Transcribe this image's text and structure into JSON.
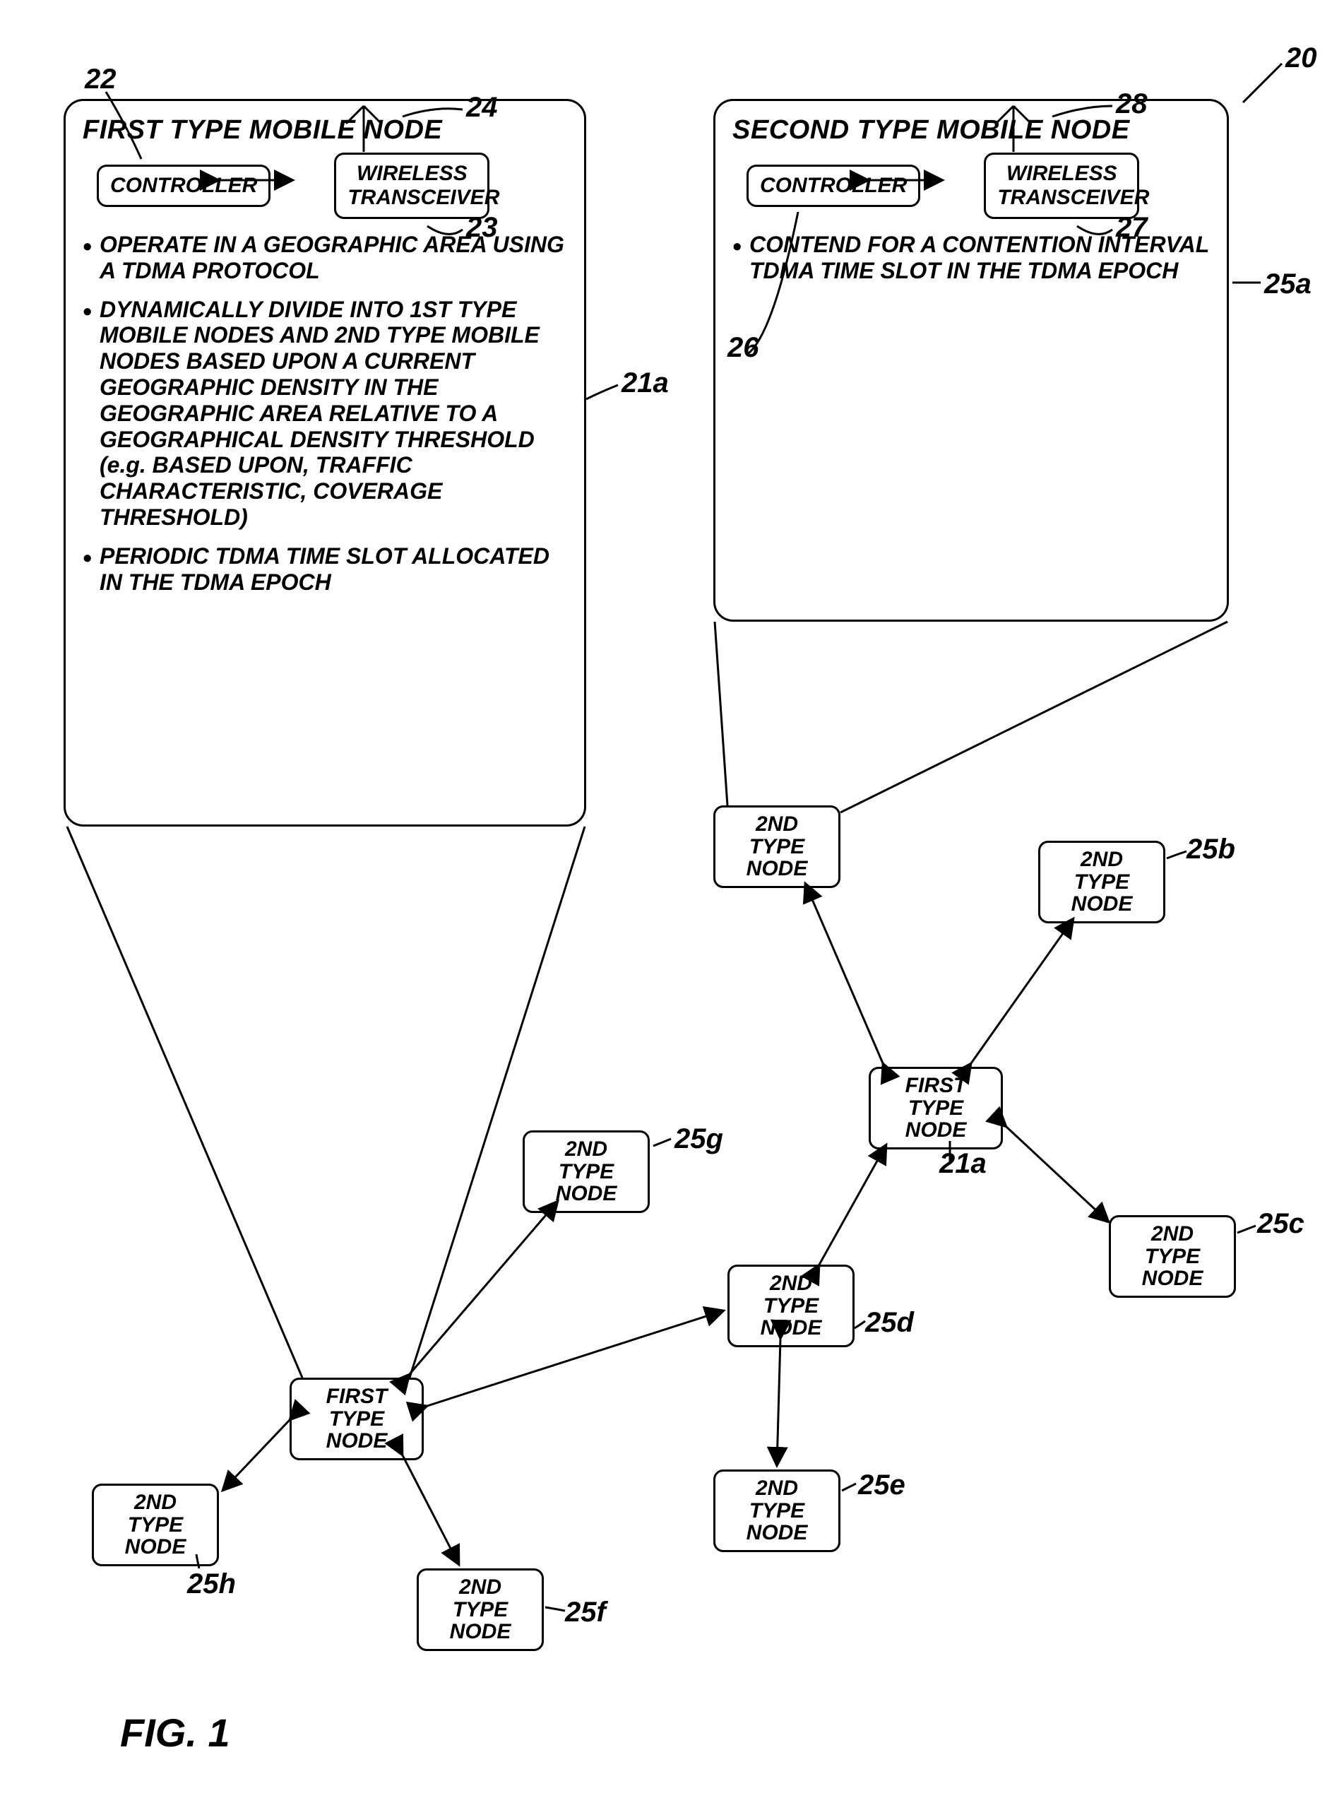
{
  "figure_label": "FIG. 1",
  "system_label": "20",
  "first_type_box": {
    "title": "FIRST TYPE MOBILE NODE",
    "controller": "CONTROLLER",
    "controller_ref": "22",
    "transceiver": "WIRELESS TRANSCEIVER",
    "transceiver_ref": "23",
    "antenna_ref": "24",
    "detail_ref": "21a",
    "bullets": {
      "b1": "OPERATE IN A GEOGRAPHIC AREA USING A TDMA PROTOCOL",
      "b2": "DYNAMICALLY DIVIDE INTO 1ST TYPE MOBILE NODES AND 2ND TYPE MOBILE NODES BASED UPON A CURRENT GEOGRAPHIC DENSITY IN THE GEOGRAPHIC AREA RELATIVE TO A GEOGRAPHICAL DENSITY THRESHOLD (e.g. BASED UPON, TRAFFIC CHARACTERISTIC, COVERAGE THRESHOLD)",
      "b3": "PERIODIC TDMA TIME SLOT ALLOCATED IN THE TDMA EPOCH"
    }
  },
  "second_type_box": {
    "title": "SECOND TYPE MOBILE NODE",
    "controller": "CONTROLLER",
    "controller_ref": "26",
    "transceiver": "WIRELESS TRANSCEIVER",
    "transceiver_ref": "27",
    "antenna_ref": "28",
    "detail_ref": "25a",
    "bullets": {
      "b1": "CONTEND FOR A CONTENTION INTERVAL TDMA TIME SLOT IN THE TDMA EPOCH"
    }
  },
  "topology": {
    "first_left": {
      "text": "FIRST TYPE\nNODE"
    },
    "first_right": {
      "text": "FIRST TYPE\nNODE",
      "ref": "21a"
    },
    "n25a": {
      "text": "2ND TYPE\nNODE"
    },
    "n25b": {
      "text": "2ND TYPE\nNODE",
      "ref": "25b"
    },
    "n25c": {
      "text": "2ND TYPE\nNODE",
      "ref": "25c"
    },
    "n25d": {
      "text": "2ND TYPE\nNODE",
      "ref": "25d"
    },
    "n25e": {
      "text": "2ND TYPE\nNODE",
      "ref": "25e"
    },
    "n25f": {
      "text": "2ND TYPE\nNODE",
      "ref": "25f"
    },
    "n25g": {
      "text": "2ND TYPE\nNODE",
      "ref": "25g"
    },
    "n25h": {
      "text": "2ND TYPE\nNODE",
      "ref": "25h"
    }
  }
}
